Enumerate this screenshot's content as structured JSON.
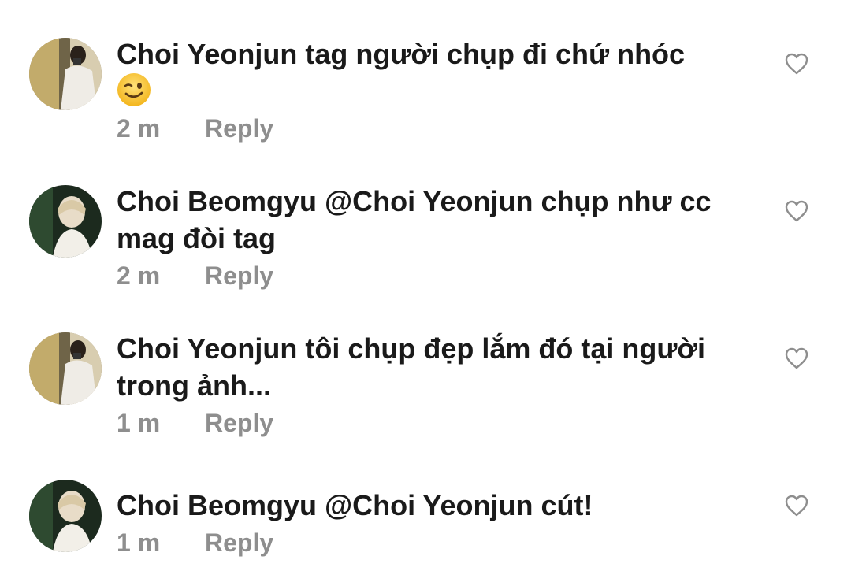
{
  "comments": [
    {
      "username": "Choi Yeonjun",
      "text": "tag người chụp đi chứ nhóc",
      "emoji": "winking-face-emoji",
      "time": "2 m",
      "reply_label": "Reply",
      "avatar": "yeonjun-avatar"
    },
    {
      "username": "Choi Beomgyu",
      "text": "@Choi Yeonjun chụp như cc mag đòi tag",
      "time": "2 m",
      "reply_label": "Reply",
      "avatar": "beomgyu-avatar"
    },
    {
      "username": "Choi Yeonjun",
      "text": "tôi chụp đẹp lắm đó tại người trong ảnh...",
      "time": "1 m",
      "reply_label": "Reply",
      "avatar": "yeonjun-avatar"
    },
    {
      "username": "Choi Beomgyu",
      "text": "@Choi Yeonjun cút!",
      "time": "1 m",
      "reply_label": "Reply",
      "avatar": "beomgyu-avatar"
    }
  ],
  "colors": {
    "text": "#1a1a1a",
    "meta": "#8e8e8e",
    "heart_outline": "#8e8e8e",
    "background": "#ffffff"
  },
  "icons": {
    "like": "heart-outline-icon"
  }
}
